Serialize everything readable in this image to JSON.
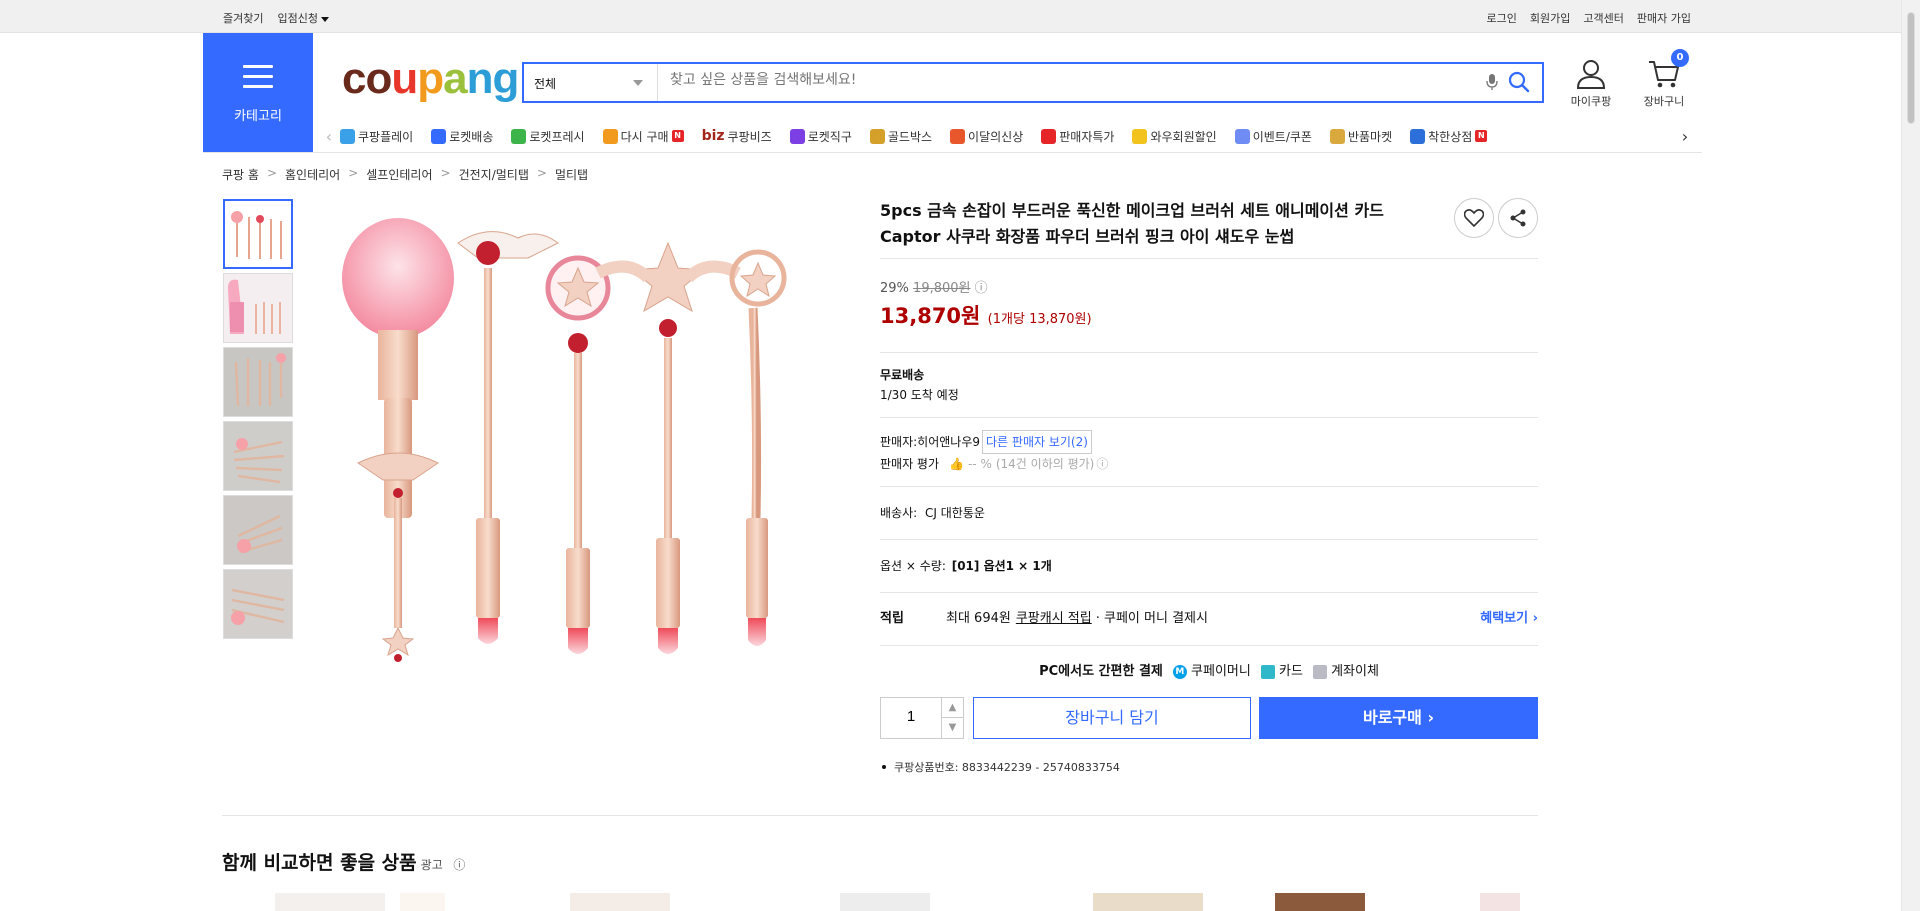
{
  "topbar": {
    "left": [
      "즐겨찾기",
      "입점신청"
    ],
    "right": [
      "로그인",
      "회원가입",
      "고객센터",
      "판매자 가입"
    ]
  },
  "header": {
    "category_label": "카테고리",
    "logo": [
      "c",
      "o",
      "u",
      "p",
      "a",
      "n",
      "g"
    ],
    "logo_colors": [
      "#692a1b",
      "#692a1b",
      "#e8362b",
      "#f29a1d",
      "#9bc13c",
      "#2c9dd7",
      "#2c9dd7"
    ],
    "search_scope": "전체",
    "search_placeholder": "찾고 싶은 상품을 검색해보세요!",
    "mypage_label": "마이쿠팡",
    "cart_label": "장바구니",
    "cart_count": "0"
  },
  "nav": [
    {
      "label": "쿠팡플레이",
      "color": "#3aa0e8",
      "badge": ""
    },
    {
      "label": "로켓배송",
      "color": "#346aff",
      "badge": ""
    },
    {
      "label": "로켓프레시",
      "color": "#3cb44a",
      "badge": ""
    },
    {
      "label": "다시 구매",
      "color": "#f29a1d",
      "badge": "N"
    },
    {
      "label": "쿠팡비즈",
      "color": "#a3261b",
      "badge": "",
      "prefix": "biz"
    },
    {
      "label": "로켓직구",
      "color": "#7b3fe4",
      "badge": ""
    },
    {
      "label": "골드박스",
      "color": "#d4a02a",
      "badge": ""
    },
    {
      "label": "이달의신상",
      "color": "#e8562b",
      "badge": ""
    },
    {
      "label": "판매자특가",
      "color": "#e52528",
      "badge": ""
    },
    {
      "label": "와우회원할인",
      "color": "#f2c21d",
      "badge": ""
    },
    {
      "label": "이벤트/쿠폰",
      "color": "#6f8cf5",
      "badge": ""
    },
    {
      "label": "반품마켓",
      "color": "#d9a93e",
      "badge": ""
    },
    {
      "label": "착한상점",
      "color": "#2d6fd8",
      "badge": "N"
    }
  ],
  "breadcrumb": [
    "쿠팡 홈",
    "홈인테리어",
    "셀프인테리어",
    "건전지/멀티탭",
    "멀티탭"
  ],
  "product": {
    "title": "5pcs 금속 손잡이 부드러운 푹신한 메이크업 브러쉬 세트 애니메이션 카드 Captor 사쿠라 화장품 파우더 브러쉬 핑크 아이 섀도우 눈썹",
    "discount": "29%",
    "original_price": "19,800원",
    "price": "13,870원",
    "unit_price": "(1개당 13,870원)",
    "shipping_title": "무료배송",
    "arrival": "1/30 도착 예정",
    "seller_label": "판매자:",
    "seller_name": "히어앤나우9",
    "other_sellers": "다른 판매자 보기(2)",
    "seller_rating_label": "판매자 평가",
    "seller_rating_value": "-- %",
    "seller_rating_note": "(14건 이하의 평가)",
    "carrier_label": "배송사:",
    "carrier": "CJ 대한통운",
    "option_label": "옵션 × 수량:",
    "option_value": "[01] 옵션1 × 1개",
    "reward_label": "적립",
    "reward_prefix": "최대 694원",
    "reward_link": "쿠팡캐시 적립",
    "reward_suffix": "· 쿠페이 머니 결제시",
    "benefit_link": "혜택보기",
    "pay_title": "PC에서도 간편한 결제",
    "pay_methods": [
      "쿠페이머니",
      "카드",
      "계좌이체"
    ],
    "quantity": "1",
    "cart_button": "장바구니 담기",
    "buy_button": "바로구매",
    "product_id": "쿠팡상품번호: 8833442239 - 25740833754"
  },
  "compare": {
    "title": "함께 비교하면 좋을 상품",
    "ad": "광고"
  }
}
